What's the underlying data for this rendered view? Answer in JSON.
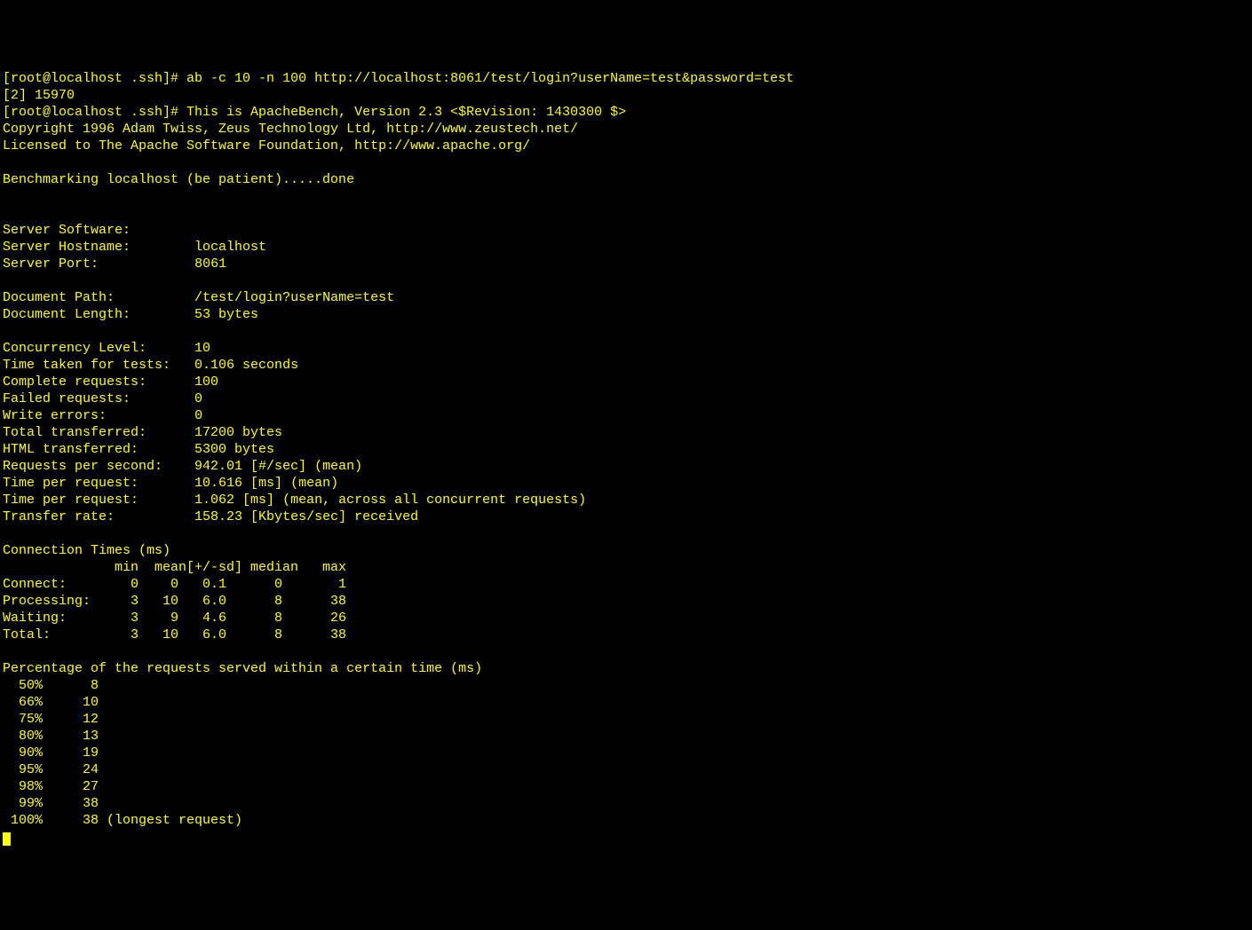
{
  "prompt1": "[root@localhost .ssh]# ",
  "command1": "ab -c 10 -n 100 http://localhost:8061/test/login?userName=test&password=test",
  "jobline": "[2] 15970",
  "prompt2": "[root@localhost .ssh]# ",
  "headerLine1": "This is ApacheBench, Version 2.3 <$Revision: 1430300 $>",
  "headerLine2": "Copyright 1996 Adam Twiss, Zeus Technology Ltd, http://www.zeustech.net/",
  "headerLine3": "Licensed to The Apache Software Foundation, http://www.apache.org/",
  "benchmarkLine": "Benchmarking localhost (be patient).....done",
  "labels": {
    "serverSoftware": "Server Software:",
    "serverHostname": "Server Hostname:",
    "serverPort": "Server Port:",
    "documentPath": "Document Path:",
    "documentLength": "Document Length:",
    "concurrencyLevel": "Concurrency Level:",
    "timeTaken": "Time taken for tests:",
    "completeRequests": "Complete requests:",
    "failedRequests": "Failed requests:",
    "writeErrors": "Write errors:",
    "totalTransferred": "Total transferred:",
    "htmlTransferred": "HTML transferred:",
    "reqPerSec": "Requests per second:",
    "timePerReq1": "Time per request:",
    "timePerReq2": "Time per request:",
    "transferRate": "Transfer rate:"
  },
  "values": {
    "serverSoftware": "",
    "serverHostname": "localhost",
    "serverPort": "8061",
    "documentPath": "/test/login?userName=test",
    "documentLength": "53 bytes",
    "concurrencyLevel": "10",
    "timeTaken": "0.106 seconds",
    "completeRequests": "100",
    "failedRequests": "0",
    "writeErrors": "0",
    "totalTransferred": "17200 bytes",
    "htmlTransferred": "5300 bytes",
    "reqPerSec": "942.01 [#/sec] (mean)",
    "timePerReq1": "10.616 [ms] (mean)",
    "timePerReq2": "1.062 [ms] (mean, across all concurrent requests)",
    "transferRate": "158.23 [Kbytes/sec] received"
  },
  "connHeader": "Connection Times (ms)",
  "connRowHeader": "              min  mean[+/-sd] median   max",
  "connRows": {
    "connect": "Connect:        0    0   0.1      0       1",
    "processing": "Processing:     3   10   6.0      8      38",
    "waiting": "Waiting:        3    9   4.6      8      26",
    "total": "Total:          3   10   6.0      8      38"
  },
  "pctHeader": "Percentage of the requests served within a certain time (ms)",
  "pctRows": {
    "p50": "  50%      8",
    "p66": "  66%     10",
    "p75": "  75%     12",
    "p80": "  80%     13",
    "p90": "  90%     19",
    "p95": "  95%     24",
    "p98": "  98%     27",
    "p99": "  99%     38",
    "p100": " 100%     38 (longest request)"
  },
  "chart_data": {
    "type": "table",
    "title": "ApacheBench Results",
    "summary": {
      "Server Hostname": "localhost",
      "Server Port": 8061,
      "Document Path": "/test/login?userName=test",
      "Document Length (bytes)": 53,
      "Concurrency Level": 10,
      "Time taken for tests (s)": 0.106,
      "Complete requests": 100,
      "Failed requests": 0,
      "Write errors": 0,
      "Total transferred (bytes)": 17200,
      "HTML transferred (bytes)": 5300,
      "Requests per second": 942.01,
      "Time per request (ms, mean)": 10.616,
      "Time per request (ms, mean across concurrent)": 1.062,
      "Transfer rate (KB/s)": 158.23
    },
    "connection_times_ms": {
      "columns": [
        "min",
        "mean",
        "sd",
        "median",
        "max"
      ],
      "Connect": [
        0,
        0,
        0.1,
        0,
        1
      ],
      "Processing": [
        3,
        10,
        6.0,
        8,
        38
      ],
      "Waiting": [
        3,
        9,
        4.6,
        8,
        26
      ],
      "Total": [
        3,
        10,
        6.0,
        8,
        38
      ]
    },
    "percentiles_ms": {
      "50": 8,
      "66": 10,
      "75": 12,
      "80": 13,
      "90": 19,
      "95": 24,
      "98": 27,
      "99": 38,
      "100": 38
    }
  }
}
